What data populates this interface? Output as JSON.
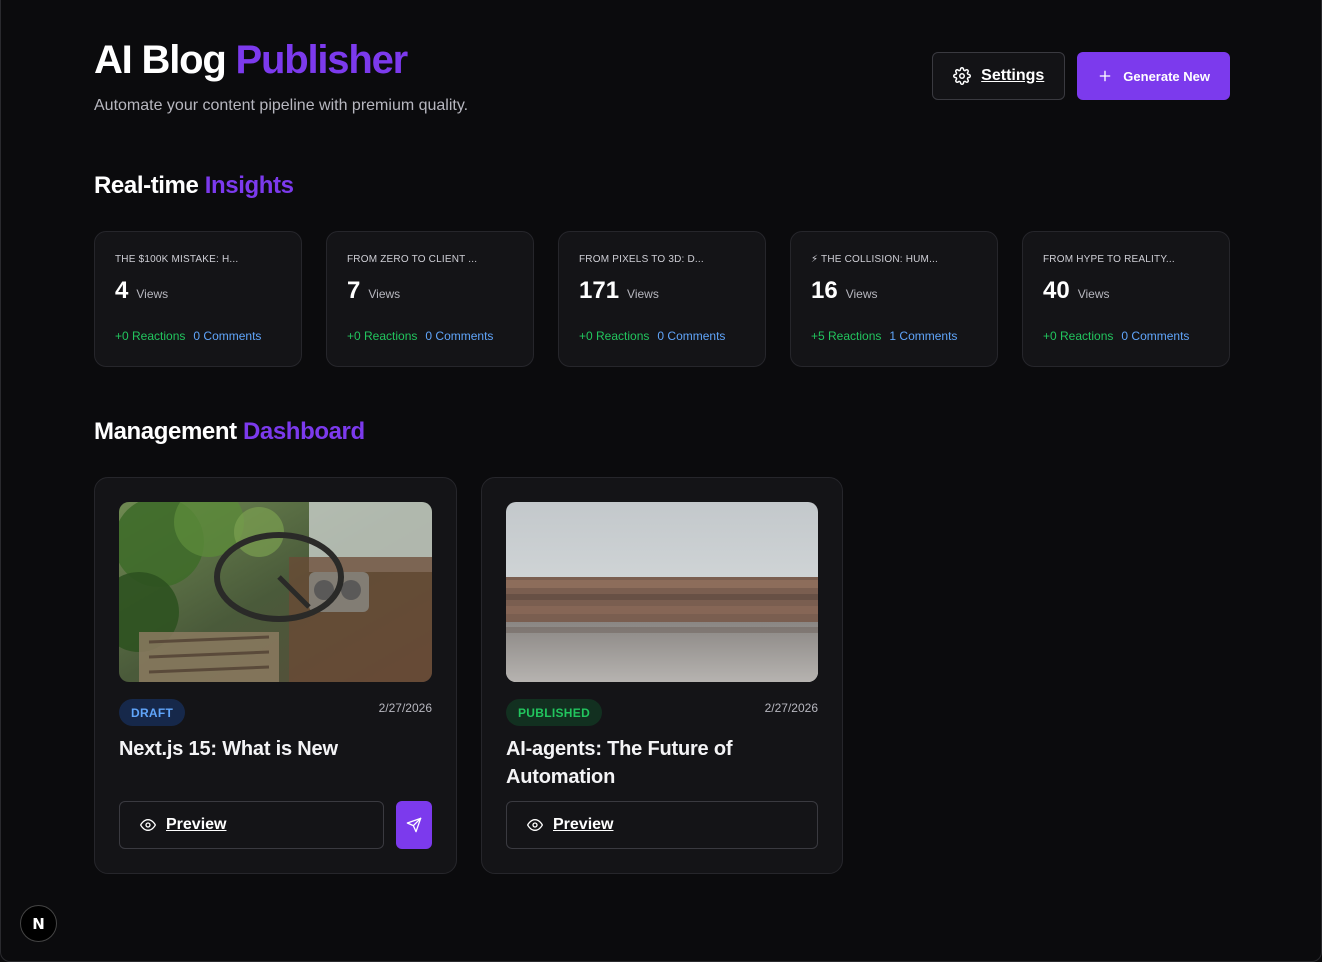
{
  "header": {
    "title_part1": "AI Blog",
    "title_part2": "Publisher",
    "subtitle": "Automate your content pipeline with premium quality.",
    "settings_label": "Settings",
    "generate_label": "Generate New"
  },
  "insights": {
    "title_part1": "Real-time",
    "title_part2": "Insights",
    "cards": [
      {
        "label": "THE $100K MISTAKE: H...",
        "views": "4",
        "views_unit": "Views",
        "reactions": "+0 Reactions",
        "comments": "0 Comments"
      },
      {
        "label": "FROM ZERO TO CLIENT ...",
        "views": "7",
        "views_unit": "Views",
        "reactions": "+0 Reactions",
        "comments": "0 Comments"
      },
      {
        "label": "FROM PIXELS TO 3D: D...",
        "views": "171",
        "views_unit": "Views",
        "reactions": "+0 Reactions",
        "comments": "0 Comments"
      },
      {
        "label": "⚡ THE COLLISION: HUM...",
        "views": "16",
        "views_unit": "Views",
        "reactions": "+5 Reactions",
        "comments": "1 Comments"
      },
      {
        "label": "FROM HYPE TO REALITY...",
        "views": "40",
        "views_unit": "Views",
        "reactions": "+0 Reactions",
        "comments": "0 Comments"
      }
    ]
  },
  "dashboard": {
    "title_part1": "Management",
    "title_part2": "Dashboard",
    "posts": [
      {
        "status": "DRAFT",
        "date": "2/27/2026",
        "title": "Next.js 15: What is New",
        "preview_label": "Preview"
      },
      {
        "status": "PUBLISHED",
        "date": "2/27/2026",
        "title": "AI-agents: The Future of Automation",
        "preview_label": "Preview"
      }
    ]
  },
  "next_badge": "N",
  "colors": {
    "accent": "#7c3aed",
    "background": "#0b0b0d",
    "card": "#141417",
    "reactions": "#22c55e",
    "comments": "#60a5fa"
  }
}
